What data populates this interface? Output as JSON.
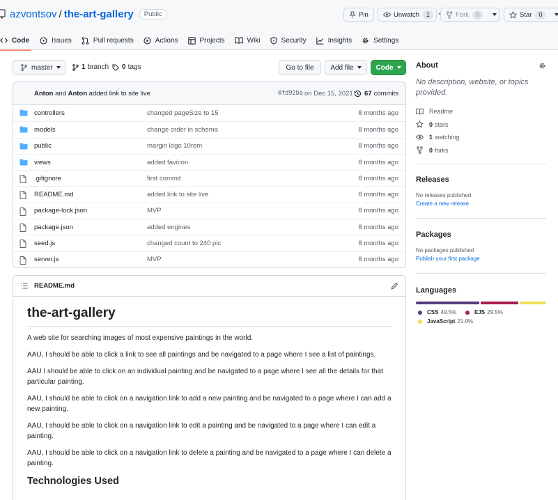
{
  "header": {
    "owner": "azvontsov",
    "separator": "/",
    "repo": "the-art-gallery",
    "visibility": "Public",
    "pin_label": "Pin",
    "watch_label": "Unwatch",
    "watch_count": "1",
    "fork_label": "Fork",
    "fork_count": "0",
    "star_label": "Star",
    "star_count": "0"
  },
  "tabs": [
    {
      "label": "Code",
      "icon": "code-icon"
    },
    {
      "label": "Issues",
      "icon": "issue-icon"
    },
    {
      "label": "Pull requests",
      "icon": "pull-request-icon"
    },
    {
      "label": "Actions",
      "icon": "play-icon"
    },
    {
      "label": "Projects",
      "icon": "table-icon"
    },
    {
      "label": "Wiki",
      "icon": "book-icon"
    },
    {
      "label": "Security",
      "icon": "shield-icon"
    },
    {
      "label": "Insights",
      "icon": "graph-icon"
    },
    {
      "label": "Settings",
      "icon": "gear-icon"
    }
  ],
  "toolbar": {
    "branch": "master",
    "branch_count": "1",
    "branch_word": "branch",
    "tags_count": "0",
    "tags_word": "tags",
    "goto_file": "Go to file",
    "add_file": "Add file",
    "code": "Code"
  },
  "commit": {
    "author1": "Anton",
    "and": "and",
    "author2": "Anton",
    "message": "added link to site live",
    "sha": "0fd92ba",
    "date": "on Dec 15, 2021",
    "count": "67",
    "count_word": "commits"
  },
  "files": [
    {
      "name": "controllers",
      "type": "dir",
      "message": "changed pageSize to 15",
      "age": "8 months ago"
    },
    {
      "name": "models",
      "type": "dir",
      "message": "change order in schema",
      "age": "8 months ago"
    },
    {
      "name": "public",
      "type": "dir",
      "message": "margin logo 10rem",
      "age": "8 months ago"
    },
    {
      "name": "views",
      "type": "dir",
      "message": "added favicon",
      "age": "8 months ago"
    },
    {
      "name": ".gitignore",
      "type": "file",
      "message": "first commit",
      "age": "8 months ago"
    },
    {
      "name": "README.md",
      "type": "file",
      "message": "added link to site live",
      "age": "8 months ago"
    },
    {
      "name": "package-lock.json",
      "type": "file",
      "message": "MVP",
      "age": "8 months ago"
    },
    {
      "name": "package.json",
      "type": "file",
      "message": "added engines",
      "age": "8 months ago"
    },
    {
      "name": "seed.js",
      "type": "file",
      "message": "changed count to 240 pic",
      "age": "8 months ago"
    },
    {
      "name": "server.js",
      "type": "file",
      "message": "MVP",
      "age": "8 months ago"
    }
  ],
  "readme": {
    "filename": "README.md",
    "title": "the-art-gallery",
    "paragraphs": [
      "A web site for searching images of most expensive paintings in the world.",
      "AAU, I should be able to click a link to see all paintings and be navigated to a page where I see a list of paintings.",
      "AAU I should be able to click on an individual painting and be navigated to a page where I see all the details for that particular painting.",
      "AAU, I should be able to click on a navigation link to add a new painting and be navigated to a page where I can add a new painting.",
      "AAU, I should be able to click on a navigation link to edit a painting and be navigated to a page where I can edit a painting.",
      "AAU, I should be able to click on a navigation link to delete a painting and be navigated to a page where I can delete a painting."
    ],
    "subheading": "Technologies Used"
  },
  "sidebar": {
    "about_title": "About",
    "description": "No description, website, or topics provided.",
    "readme": "Readme",
    "stars_count": "0",
    "stars_word": "stars",
    "watching_count": "1",
    "watching_word": "watching",
    "forks_count": "0",
    "forks_word": "forks",
    "releases_title": "Releases",
    "releases_none": "No releases published",
    "releases_link": "Create a new release",
    "packages_title": "Packages",
    "packages_none": "No packages published",
    "packages_link": "Publish your first package",
    "languages_title": "Languages",
    "languages": [
      {
        "name": "CSS",
        "percent": "49.5%",
        "value": 49.5,
        "color": "#563d7c"
      },
      {
        "name": "EJS",
        "percent": "29.5%",
        "value": 29.5,
        "color": "#a91e50"
      },
      {
        "name": "JavaScript",
        "percent": "21.0%",
        "value": 21.0,
        "color": "#f1e05a"
      }
    ]
  }
}
